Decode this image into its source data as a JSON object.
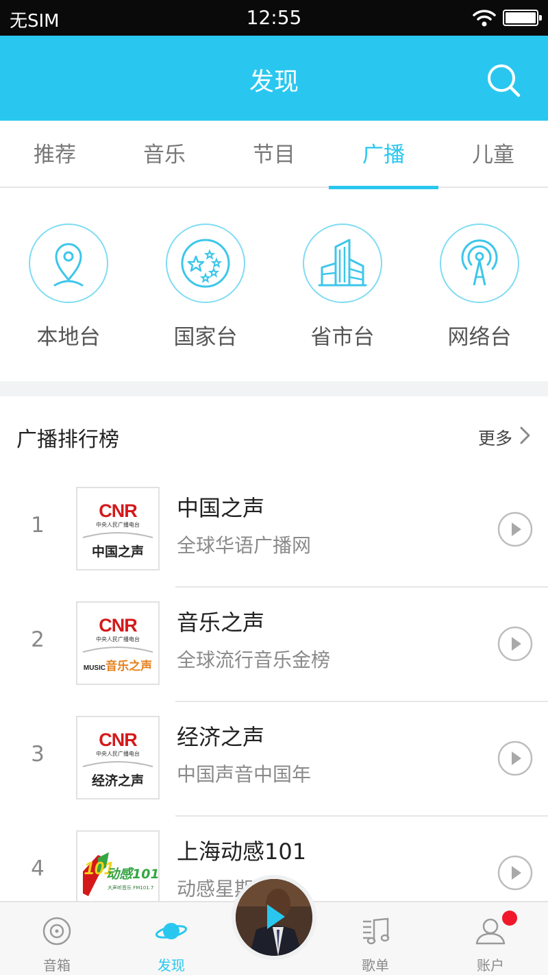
{
  "status_bar": {
    "carrier": "无SIM",
    "time": "12:55"
  },
  "header": {
    "title": "发现",
    "search_icon": "search-icon"
  },
  "tabs": [
    {
      "label": "推荐",
      "active": false
    },
    {
      "label": "音乐",
      "active": false
    },
    {
      "label": "节目",
      "active": false
    },
    {
      "label": "广播",
      "active": true
    },
    {
      "label": "儿童",
      "active": false
    }
  ],
  "categories": [
    {
      "label": "本地台",
      "icon": "location-pin-icon"
    },
    {
      "label": "国家台",
      "icon": "stars-emblem-icon"
    },
    {
      "label": "省市台",
      "icon": "buildings-icon"
    },
    {
      "label": "网络台",
      "icon": "radio-tower-icon"
    }
  ],
  "ranking": {
    "title": "广播排行榜",
    "more_label": "更多",
    "items": [
      {
        "rank": "1",
        "name": "中国之声",
        "subtitle": "全球华语广播网",
        "logo_brand": "CNR",
        "logo_org": "中央人民广播电台",
        "logo_channel": "中国之声"
      },
      {
        "rank": "2",
        "name": "音乐之声",
        "subtitle": "全球流行音乐金榜",
        "logo_brand": "CNR",
        "logo_org": "中央人民广播电台",
        "logo_channel": "音乐之声",
        "logo_prefix": "MUSIC"
      },
      {
        "rank": "3",
        "name": "经济之声",
        "subtitle": "中国声音中国年",
        "logo_brand": "CNR",
        "logo_org": "中央人民广播电台",
        "logo_channel": "经济之声"
      },
      {
        "rank": "4",
        "name": "上海动感101",
        "subtitle": "动感星期",
        "logo_brand": "101",
        "logo_channel": "动感101",
        "logo_tagline": "大声听音乐 FM101.7"
      }
    ]
  },
  "bottom_nav": [
    {
      "label": "音箱",
      "icon": "speaker-icon",
      "active": false
    },
    {
      "label": "发现",
      "icon": "planet-icon",
      "active": true
    },
    {
      "label": "歌单",
      "icon": "playlist-icon",
      "active": false
    },
    {
      "label": "账户",
      "icon": "user-icon",
      "active": false,
      "badge": true
    }
  ],
  "colors": {
    "accent": "#29c7ef",
    "badge": "#f0192b",
    "cnr_red": "#d4191b",
    "dg_green": "#35a544"
  }
}
